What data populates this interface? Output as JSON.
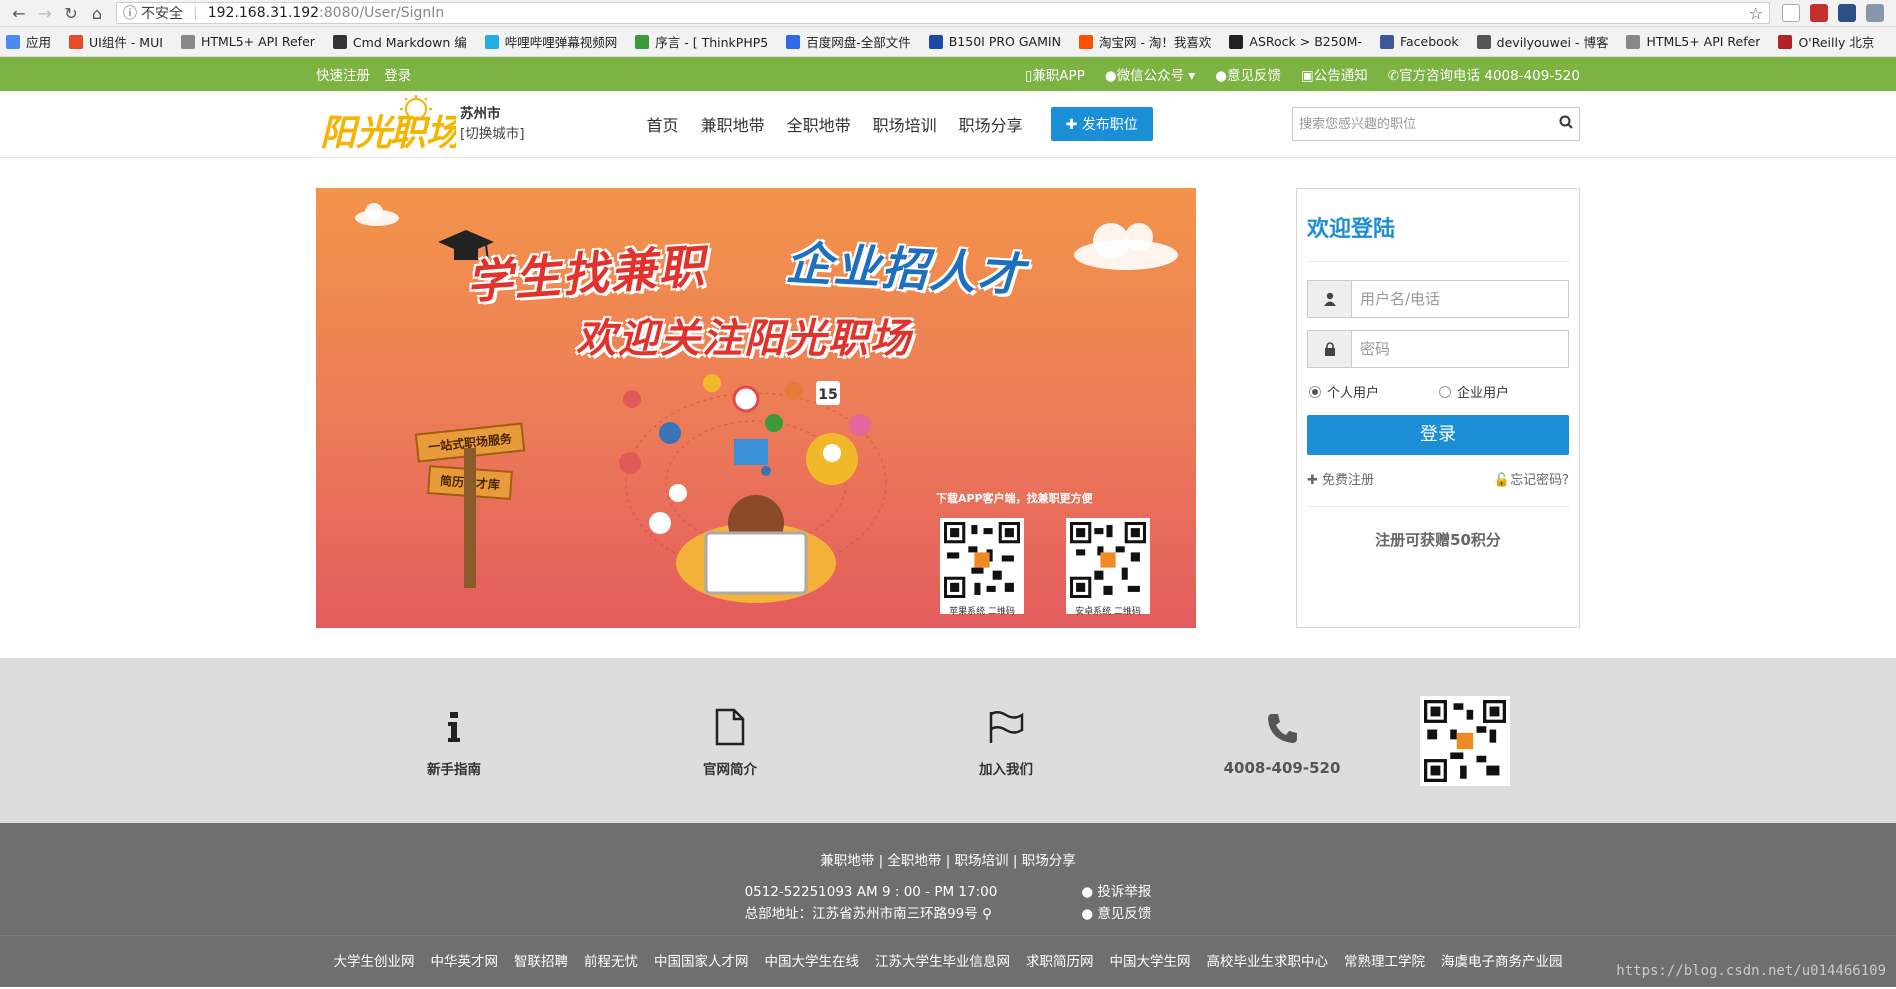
{
  "browser": {
    "security_label": "不安全",
    "url_host": "192.168.31.192",
    "url_rest": ":8080/User/SignIn"
  },
  "bookmarks": [
    {
      "label": "应用",
      "icon": "apps-grid-icon",
      "color": "#4a8af4"
    },
    {
      "label": "UI组件 - MUI",
      "icon": "mui-icon",
      "color": "#e44d26"
    },
    {
      "label": "HTML5+ API Refer",
      "icon": "page-icon",
      "color": "#888888"
    },
    {
      "label": "Cmd Markdown 编",
      "icon": "cmd-icon",
      "color": "#333333"
    },
    {
      "label": "哔哩哔哩弹幕视频网",
      "icon": "bilibili-icon",
      "color": "#23ade5"
    },
    {
      "label": "序言 - [ ThinkPHP5",
      "icon": "thinkphp-icon",
      "color": "#3c9a3c"
    },
    {
      "label": "百度网盘-全部文件",
      "icon": "baidu-pan-icon",
      "color": "#2d6ae3"
    },
    {
      "label": "B150I PRO GAMIN",
      "icon": "msi-icon",
      "color": "#1b4aa8"
    },
    {
      "label": "淘宝网 - 淘！我喜欢",
      "icon": "taobao-icon",
      "color": "#ff5000"
    },
    {
      "label": "ASRock > B250M-",
      "icon": "asrock-icon",
      "color": "#222222"
    },
    {
      "label": "Facebook",
      "icon": "facebook-icon",
      "color": "#3b5998"
    },
    {
      "label": "devilyouwei - 博客",
      "icon": "blog-icon",
      "color": "#555555"
    },
    {
      "label": "HTML5+ API Refer",
      "icon": "page-icon",
      "color": "#888888"
    },
    {
      "label": "O'Reilly 北京",
      "icon": "oreilly-icon",
      "color": "#b22222"
    }
  ],
  "topbar": {
    "quick_register": "快速注册",
    "login": "登录",
    "app": "兼职APP",
    "wechat": "微信公众号",
    "feedback": "意见反馈",
    "notice": "公告通知",
    "hotline": "官方咨询电话 4008-409-520"
  },
  "header": {
    "city": "苏州市",
    "switch_city": "[切换城市]",
    "nav": [
      "首页",
      "兼职地带",
      "全职地带",
      "职场培训",
      "职场分享"
    ],
    "publish": "发布职位",
    "search_placeholder": "搜索您感兴趣的职位"
  },
  "banner": {
    "title1": "学生找兼职",
    "title2": "企业招人才",
    "title3": "欢迎关注阳光职场",
    "sign1": "一站式职场服务",
    "sign2": "简历人才库",
    "download": "下载APP客户端，找兼职更方便",
    "qr_ios": "苹果系统  二维码",
    "qr_android": "安卓系统  二维码",
    "calendar": "15"
  },
  "login": {
    "title": "欢迎登陆",
    "username_placeholder": "用户名/电话",
    "password_placeholder": "密码",
    "role_personal": "个人用户",
    "role_company": "企业用户",
    "submit": "登录",
    "register": "免费注册",
    "forgot": "忘记密码?",
    "bonus": "注册可获赠50积分"
  },
  "band": {
    "guide": "新手指南",
    "intro": "官网简介",
    "join": "加入我们",
    "phone": "4008-409-520"
  },
  "footer": {
    "nav": "兼职地带 | 全职地带 | 职场培训 | 职场分享",
    "hours": "0512-52251093 AM 9 : 00 - PM 17:00",
    "address": "总部地址：江苏省苏州市南三环路99号",
    "report": "投诉举报",
    "feedback": "意见反馈",
    "links": [
      "大学生创业网",
      "中华英才网",
      "智联招聘",
      "前程无忧",
      "中国国家人才网",
      "中国大学生在线",
      "江苏大学生毕业信息网",
      "求职简历网",
      "中国大学生网",
      "高校毕业生求职中心",
      "常熟理工学院",
      "海虞电子商务产业园"
    ],
    "watermark": "https://blog.csdn.net/u014466109"
  },
  "colors": {
    "green": "#7cb342",
    "blue": "#1b8fd6",
    "footer": "#6f6f6f"
  }
}
